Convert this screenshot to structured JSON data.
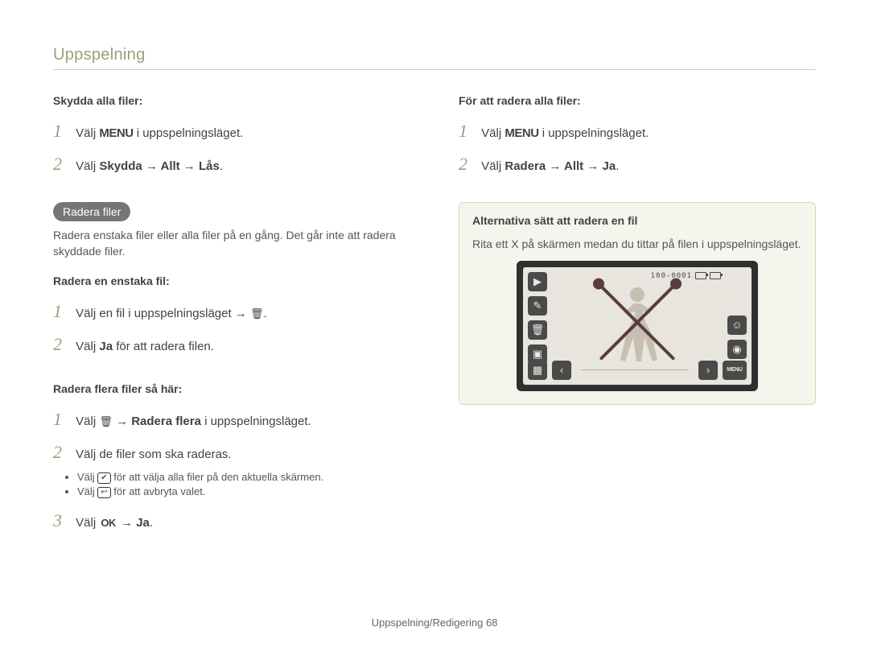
{
  "page_title": "Uppspelning",
  "left": {
    "protect_all": {
      "heading": "Skydda alla filer:",
      "step1_pre": "Välj ",
      "step1_menu": "MENU",
      "step1_post": " i uppspelningsläget.",
      "step2_pre": "Välj ",
      "step2_bold": "Skydda → Allt → Lås",
      "step2_post": "."
    },
    "delete_pill": "Radera filer",
    "delete_intro": "Radera enstaka filer eller alla filer på en gång. Det går inte att radera skyddade filer.",
    "delete_single": {
      "heading": "Radera en enstaka fil:",
      "step1": "Välj en fil i uppspelningsläget → ",
      "step1_post": ".",
      "step2_pre": "Välj ",
      "step2_bold": "Ja",
      "step2_post": " för att radera filen."
    },
    "delete_multi": {
      "heading": "Radera flera filer så här:",
      "step1_pre": "Välj ",
      "step1_bold": " → Radera flera",
      "step1_post": " i uppspelningsläget.",
      "step2": "Välj de filer som ska raderas.",
      "bullet1_pre": "Välj ",
      "bullet1_post": " för att välja alla filer på den aktuella skärmen.",
      "bullet2_pre": "Välj ",
      "bullet2_post": " för att avbryta valet.",
      "step3_pre": "Välj ",
      "step3_ok": "OK",
      "step3_bold": " → Ja",
      "step3_post": "."
    }
  },
  "right": {
    "delete_all": {
      "heading": "För att radera alla filer:",
      "step1_pre": "Välj ",
      "step1_menu": "MENU",
      "step1_post": " i uppspelningsläget.",
      "step2_pre": "Välj ",
      "step2_bold": "Radera → Allt → Ja",
      "step2_post": "."
    },
    "tip": {
      "heading": "Alternativa sätt att radera en fil",
      "text": "Rita ett X på skärmen medan du tittar på filen i uppspelningsläget."
    },
    "screen": {
      "top_counter": "100-0001",
      "menu_label": "MENU"
    }
  },
  "footer_pre": "Uppspelning/Redigering  ",
  "footer_page": "68"
}
